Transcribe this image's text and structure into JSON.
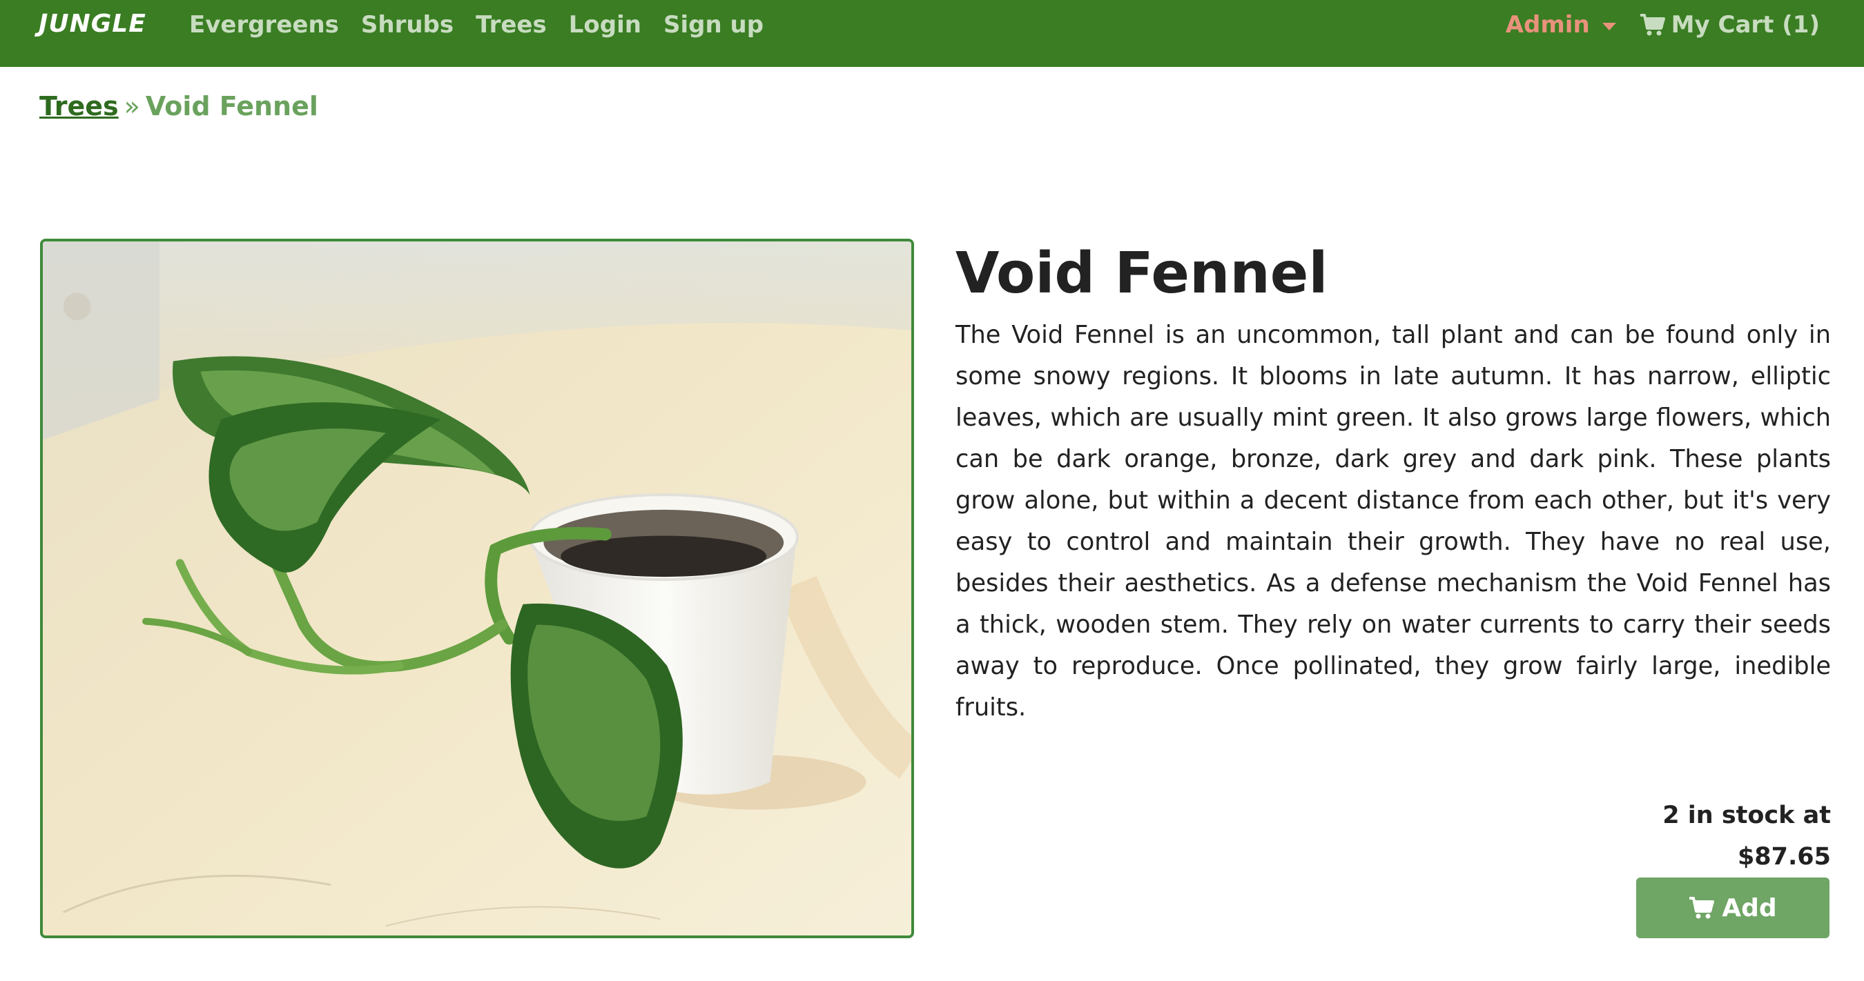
{
  "navbar": {
    "brand": "JUNGLE",
    "links": [
      "Evergreens",
      "Shrubs",
      "Trees",
      "Login",
      "Sign up"
    ],
    "admin_label": "Admin",
    "cart_label": "My Cart (1)",
    "icons": {
      "cart": "shopping-cart-icon",
      "caret": "caret-down-icon"
    },
    "colors": {
      "background": "#3a7d23",
      "admin": "#e8927c",
      "link": "#c8dcc0"
    }
  },
  "breadcrumb": {
    "parent": "Trees",
    "separator": "»",
    "current": "Void Fennel"
  },
  "product": {
    "name": "Void Fennel",
    "description": "The Void Fennel is an uncommon, tall plant and can be found only in some snowy regions. It blooms in late autumn. It has narrow, elliptic leaves, which are usually mint green. It also grows large flowers, which can be dark orange, bronze, dark grey and dark pink. These plants grow alone, but within a decent distance from each other, but it's very easy to control and maintain their growth. They have no real use, besides their aesthetics. As a defense mechanism the Void Fennel has a thick, wooden stem. They rely on water currents to carry their seeds away to reproduce. Once pollinated, they grow fairly large, inedible fruits.",
    "stock_text": "2 in stock at",
    "price": "$87.65",
    "add_button_label": "Add",
    "image_description_icon": "potted-plant-photo"
  }
}
